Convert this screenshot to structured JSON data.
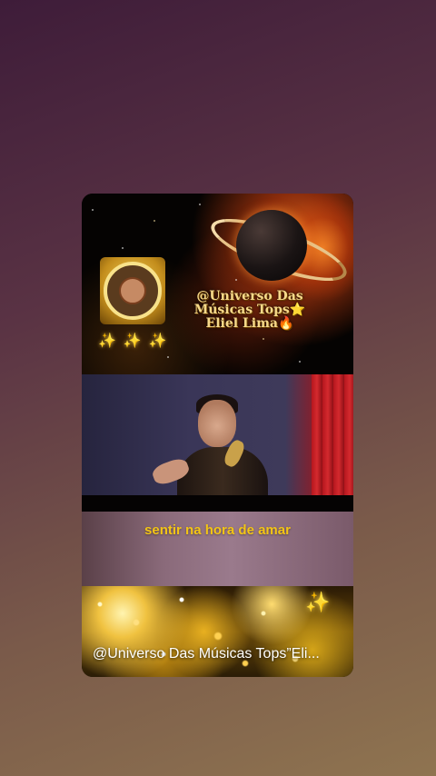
{
  "banner": {
    "brand_line1": "@Universo Das",
    "brand_line2": "Músicas Tops⭐",
    "brand_line3": "Eliel Lima🔥",
    "sparkles": [
      "✨",
      "✨",
      "✨"
    ]
  },
  "lyric": {
    "text": "sentir na hora de amar"
  },
  "caption": {
    "text": "@Universo Das Músicas Tops”Eli..."
  },
  "glitter": {
    "sparkle": "✨"
  },
  "colors": {
    "lyric": "#f3c515",
    "brand_text": "#f6d98a"
  }
}
